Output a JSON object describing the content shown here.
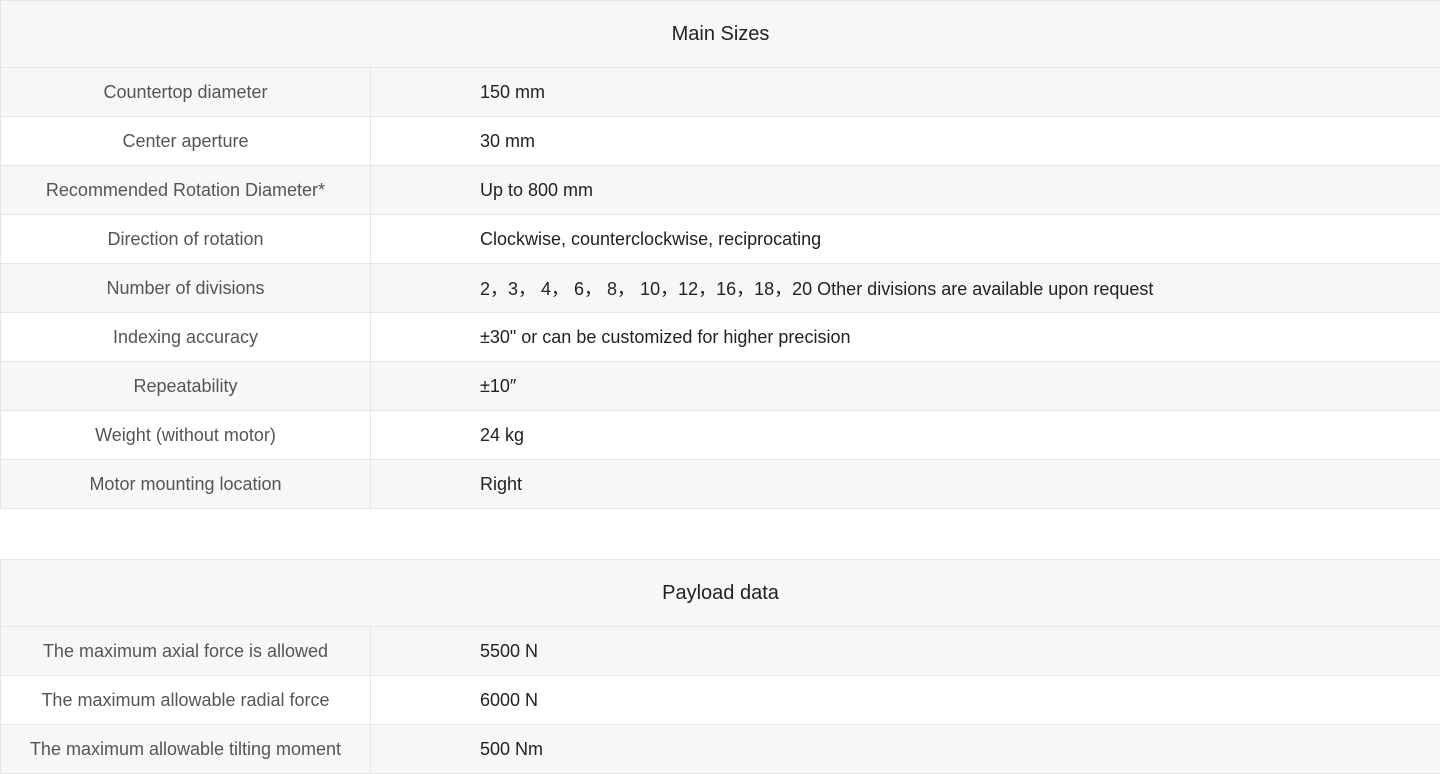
{
  "main_sizes": {
    "title": "Main Sizes",
    "rows": [
      {
        "label": "Countertop diameter",
        "value": "150 mm"
      },
      {
        "label": "Center aperture",
        "value": "30 mm"
      },
      {
        "label": "Recommended Rotation Diameter*",
        "value": "Up to 800 mm"
      },
      {
        "label": "Direction of rotation",
        "value": "Clockwise, counterclockwise, reciprocating"
      },
      {
        "label": "Number of divisions",
        "value": "2，3， 4， 6， 8， 10，12，16，18，20  Other divisions are available upon request"
      },
      {
        "label": "Indexing accuracy",
        "value": "±30\" or can be customized for higher precision"
      },
      {
        "label": "Repeatability",
        "value": "±10″"
      },
      {
        "label": "Weight (without motor)",
        "value": "24 kg"
      },
      {
        "label": "Motor mounting location",
        "value": "Right"
      }
    ]
  },
  "payload_data": {
    "title": "Payload data",
    "rows": [
      {
        "label": "The maximum axial force is allowed",
        "value": "5500 N"
      },
      {
        "label": "The maximum allowable radial force",
        "value": "6000 N"
      },
      {
        "label": "The maximum allowable tilting moment",
        "value": "500 Nm"
      }
    ]
  }
}
